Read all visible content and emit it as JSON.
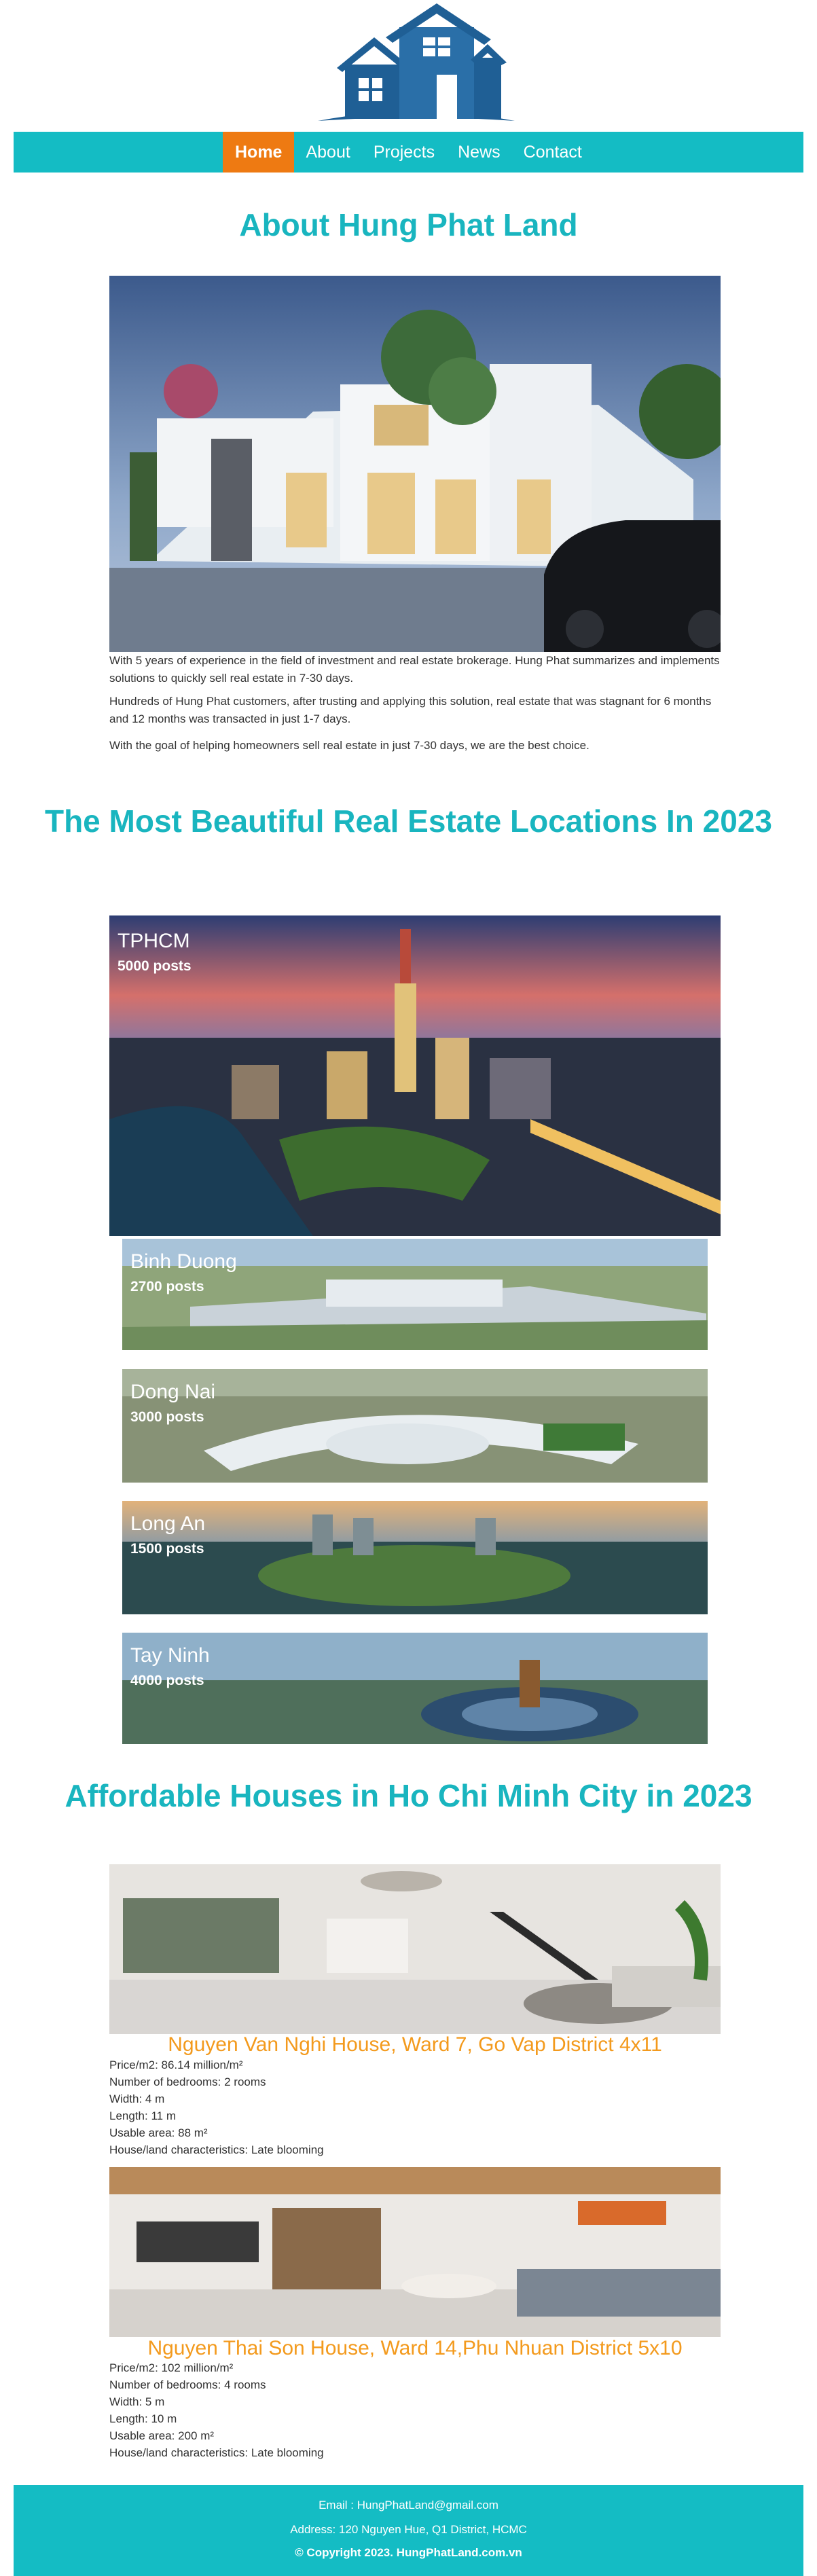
{
  "nav": {
    "items": [
      {
        "label": "Home",
        "active": true
      },
      {
        "label": "About",
        "active": false
      },
      {
        "label": "Projects",
        "active": false
      },
      {
        "label": "News",
        "active": false
      },
      {
        "label": "Contact",
        "active": false
      }
    ]
  },
  "about": {
    "title": "About Hung Phat Land",
    "paragraphs": [
      "With 5 years of experience in the field of investment and real estate brokerage. Hung Phat summarizes and implements solutions to quickly sell real estate in 7-30 days.",
      "Hundreds of Hung Phat customers, after trusting and applying this solution, real estate that was stagnant for 6 months and 12 months was transacted in just 1-7 days.",
      "With the goal of helping homeowners sell real estate in just 7-30 days, we are the best choice."
    ]
  },
  "locations": {
    "title": "The Most Beautiful Real Estate Locations In 2023",
    "items": [
      {
        "name": "TPHCM",
        "posts": "5000 posts"
      },
      {
        "name": "Binh Duong",
        "posts": "2700 posts"
      },
      {
        "name": "Dong Nai",
        "posts": "3000 posts"
      },
      {
        "name": "Long An",
        "posts": "1500 posts"
      },
      {
        "name": "Tay Ninh",
        "posts": "4000 posts"
      }
    ]
  },
  "houses": {
    "title": "Affordable Houses in Ho Chi Minh City in 2023",
    "items": [
      {
        "title": "Nguyen Van Nghi House, Ward 7, Go Vap District 4x11",
        "specs": [
          "Price/m2: 86.14 million/m²",
          "Number of bedrooms: 2 rooms",
          "Width: 4 m",
          "Length: 11 m",
          "Usable area: 88 m²",
          "House/land characteristics: Late blooming"
        ]
      },
      {
        "title": "Nguyen Thai Son House, Ward 14,Phu Nhuan District 5x10",
        "specs": [
          "Price/m2: 102 million/m²",
          "Number of bedrooms: 4 rooms",
          "Width: 5 m",
          "Length: 10 m",
          "Usable area: 200 m²",
          "House/land characteristics: Late blooming"
        ]
      }
    ]
  },
  "footer": {
    "email": "Email : HungPhatLand@gmail.com",
    "address": "Address: 120 Nguyen Hue, Q1 District, HCMC",
    "copyright": "© Copyright 2023. HungPhatLand.com.vn"
  },
  "colors": {
    "brand_teal": "#14bcc4",
    "title_teal": "#19b5bf",
    "nav_active": "#ee7a12",
    "house_title": "#f39a1d",
    "logo_blue": "#1f5f95"
  },
  "icons": [
    "house-logo-icon"
  ]
}
